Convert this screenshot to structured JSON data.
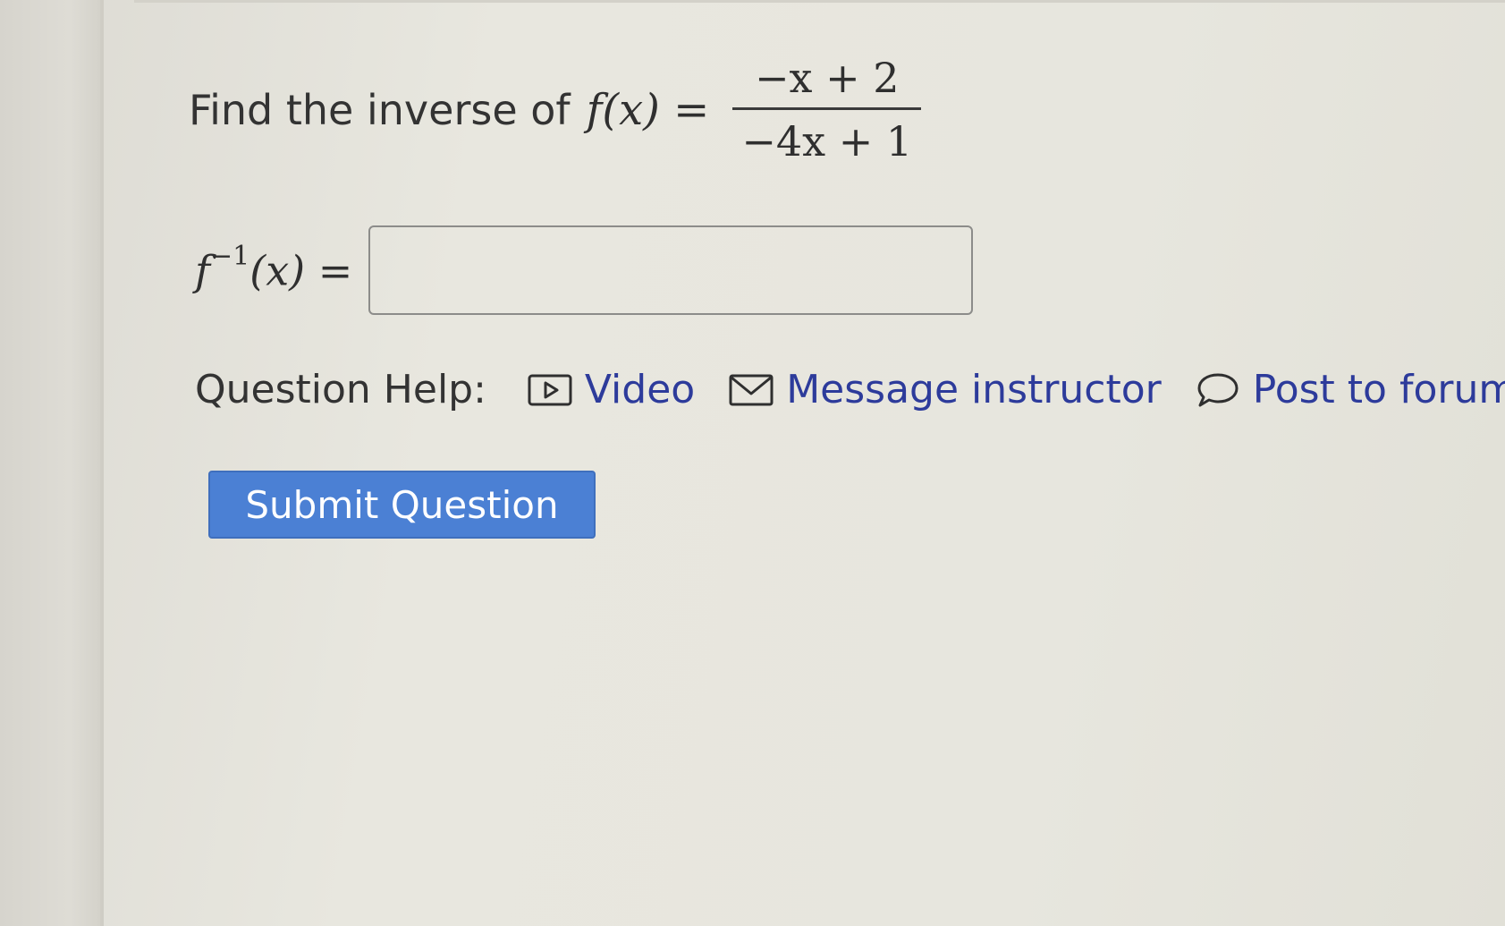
{
  "question": {
    "prompt": "Find the inverse of",
    "function_lhs": "f(x)",
    "equals": "=",
    "numerator": "−x + 2",
    "denominator": "−4x + 1"
  },
  "answer": {
    "label_base": "f",
    "label_sup": "−1",
    "label_arg": "(x)",
    "equals": "=",
    "value": ""
  },
  "help": {
    "label": "Question Help:",
    "video": {
      "label": "Video",
      "icon": "video-play-icon"
    },
    "message": {
      "label": "Message instructor",
      "icon": "envelope-icon"
    },
    "forum": {
      "label": "Post to forum",
      "icon": "speech-bubble-icon"
    },
    "link_color": "#2d3b9b"
  },
  "submit": {
    "label": "Submit Question",
    "color": "#4b80d4"
  }
}
